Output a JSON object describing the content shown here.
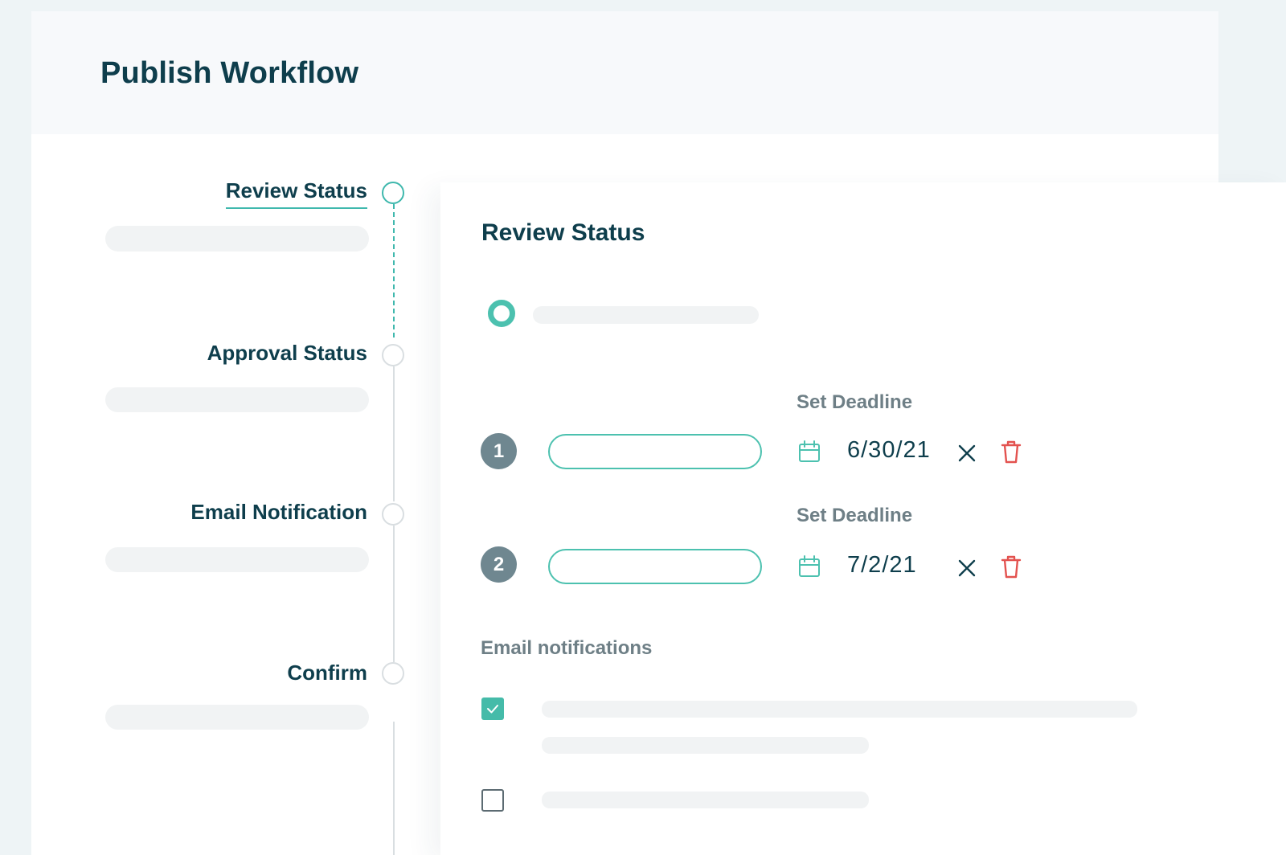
{
  "header": {
    "title": "Publish Workflow"
  },
  "stepper": {
    "steps": [
      {
        "label": "Review Status",
        "active": true
      },
      {
        "label": "Approval Status",
        "active": false
      },
      {
        "label": "Email Notification",
        "active": false
      },
      {
        "label": "Confirm",
        "active": false
      }
    ]
  },
  "card": {
    "title": "Review Status",
    "reviewers": [
      {
        "number": "1",
        "deadline_label": "Set Deadline",
        "deadline": "6/30/21"
      },
      {
        "number": "2",
        "deadline_label": "Set Deadline",
        "deadline": "7/2/21"
      }
    ],
    "email_section_label": "Email notifications",
    "email_options": [
      {
        "checked": true
      },
      {
        "checked": false
      }
    ]
  },
  "colors": {
    "accent": "#3fb8ad",
    "heading": "#0e3e4c",
    "muted": "#6e7f86",
    "danger": "#e3524f",
    "badge": "#6f8790",
    "skeleton": "#f1f3f4"
  },
  "icons": {
    "calendar": "calendar-icon",
    "clear": "close-icon",
    "delete": "trash-icon",
    "check": "check-icon"
  }
}
